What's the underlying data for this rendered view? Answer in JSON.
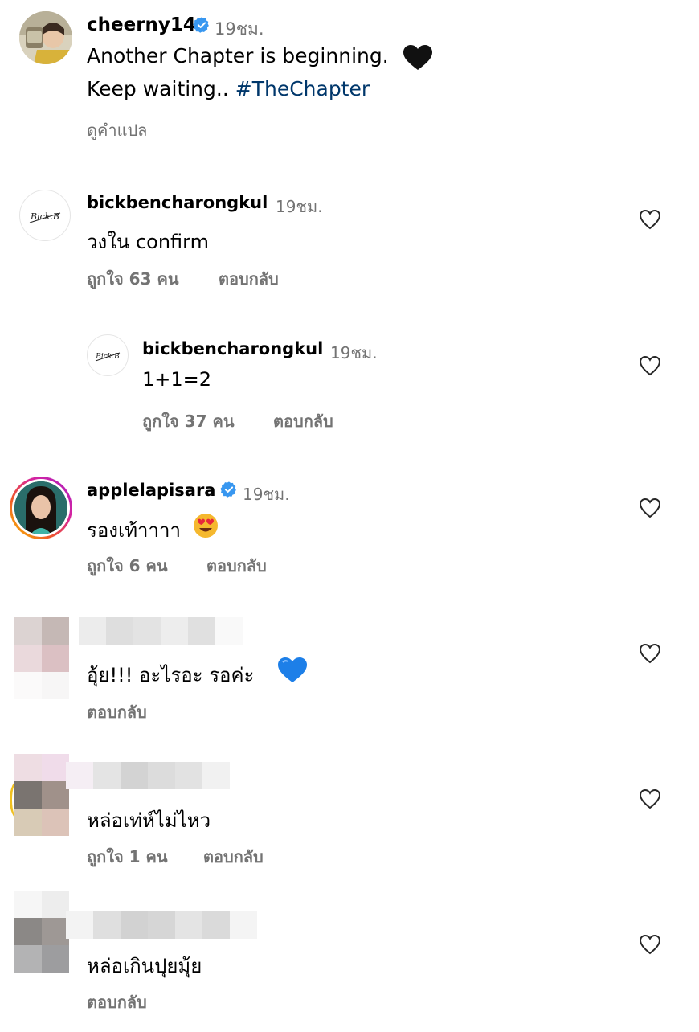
{
  "post": {
    "username": "cheerny14",
    "time": "19ชม.",
    "caption_line1": "Another Chapter is beginning.",
    "caption_line2_prefix": "Keep waiting.. ",
    "caption_hashtag": "#TheChapter",
    "translate_label": "ดูคำแปล"
  },
  "comments": [
    {
      "username": "bickbencharongkul",
      "time": "19ชม.",
      "text": "วงใน confirm",
      "likes": "ถูกใจ 63 คน",
      "reply": "ตอบกลับ",
      "avatar_text": "Bick.B"
    },
    {
      "username": "bickbencharongkul",
      "time": "19ชม.",
      "text": "1+1=2",
      "likes": "ถูกใจ 37 คน",
      "reply": "ตอบกลับ",
      "avatar_text": "Bick.B"
    },
    {
      "username": "applelapisara",
      "time": "19ชม.",
      "text": "รองเท้าาาา",
      "likes": "ถูกใจ 6 คน",
      "reply": "ตอบกลับ"
    },
    {
      "text": "อุ้ย!!! อะไรอะ  รอค่ะ",
      "reply": "ตอบกลับ"
    },
    {
      "text": "หล่อเท่ห์ไม่ไหว",
      "likes": "ถูกใจ 1 คน",
      "reply": "ตอบกลับ"
    },
    {
      "text": "หล่อเกินปุยมุ้ย",
      "reply": "ตอบกลับ"
    }
  ],
  "colors": {
    "verified": "#3897f0",
    "hashtag": "#00376b",
    "muted": "#737373",
    "heart_stroke": "#262626",
    "blue_heart": "#1d7fe8"
  },
  "icons": [
    "verified-badge-icon",
    "heart-outline-icon",
    "black-heart-emoji",
    "heart-eyes-emoji",
    "blue-heart-emoji"
  ]
}
